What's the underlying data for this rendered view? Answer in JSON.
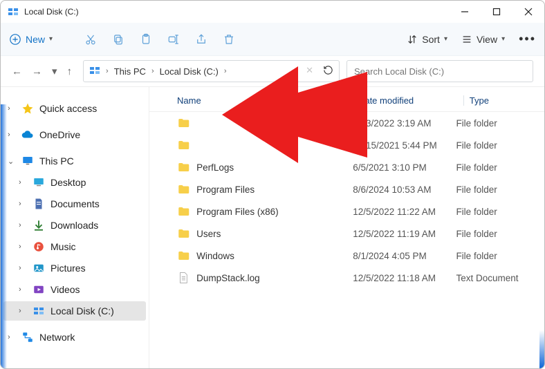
{
  "window": {
    "title": "Local Disk (C:)"
  },
  "toolbar": {
    "new_label": "New",
    "sort_label": "Sort",
    "view_label": "View"
  },
  "breadcrumb": {
    "level1": "This PC",
    "level2": "Local Disk (C:)"
  },
  "search": {
    "placeholder": "Search Local Disk (C:)"
  },
  "columns": {
    "name": "Name",
    "date": "Date modified",
    "type": "Type"
  },
  "sidebar": {
    "quick_access": "Quick access",
    "onedrive": "OneDrive",
    "this_pc": "This PC",
    "desktop": "Desktop",
    "documents": "Documents",
    "downloads": "Downloads",
    "music": "Music",
    "pictures": "Pictures",
    "videos": "Videos",
    "local_disk": "Local Disk (C:)",
    "network": "Network"
  },
  "rows": [
    {
      "name": "",
      "date": "5/13/2022 3:19 AM",
      "type": "File folder",
      "icon": "folder"
    },
    {
      "name": "",
      "date": "10/15/2021 5:44 PM",
      "type": "File folder",
      "icon": "folder"
    },
    {
      "name": "PerfLogs",
      "date": "6/5/2021 3:10 PM",
      "type": "File folder",
      "icon": "folder"
    },
    {
      "name": "Program Files",
      "date": "8/6/2024 10:53 AM",
      "type": "File folder",
      "icon": "folder"
    },
    {
      "name": "Program Files (x86)",
      "date": "12/5/2022 11:22 AM",
      "type": "File folder",
      "icon": "folder"
    },
    {
      "name": "Users",
      "date": "12/5/2022 11:19 AM",
      "type": "File folder",
      "icon": "folder"
    },
    {
      "name": "Windows",
      "date": "8/1/2024 4:05 PM",
      "type": "File folder",
      "icon": "folder"
    },
    {
      "name": "DumpStack.log",
      "date": "12/5/2022 11:18 AM",
      "type": "Text Document",
      "icon": "file"
    }
  ]
}
